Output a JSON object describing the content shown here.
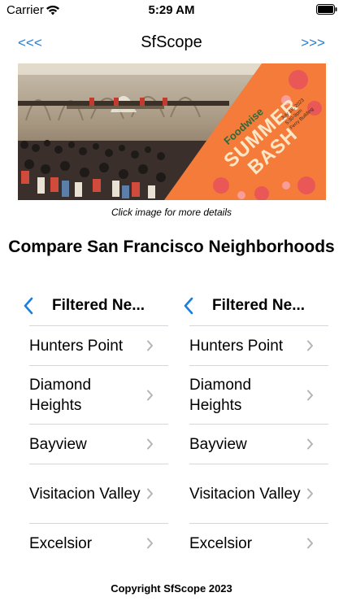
{
  "status_bar": {
    "carrier": "Carrier",
    "time": "5:29 AM"
  },
  "nav": {
    "title": "SfScope",
    "prev_label": "<<<",
    "next_label": ">>>"
  },
  "banner": {
    "caption": "Click image for more details",
    "poster": {
      "brand": "Foodwise",
      "line1": "SUMMER",
      "line2": "BASH",
      "date": "July 18, 2023",
      "time": "5:30-9pm",
      "venue": "Ferry Building"
    }
  },
  "heading": "Compare San Francisco Neighborhoods",
  "columns": [
    {
      "title": "Filtered Ne...",
      "items": [
        {
          "label": "Hunters Point"
        },
        {
          "label": "Diamond Heights"
        },
        {
          "label": "Bayview"
        },
        {
          "label": "Visitacion Valley"
        },
        {
          "label": "Excelsior"
        }
      ]
    },
    {
      "title": "Filtered Ne...",
      "items": [
        {
          "label": "Hunters Point"
        },
        {
          "label": "Diamond Heights"
        },
        {
          "label": "Bayview"
        },
        {
          "label": "Visitacion Valley"
        },
        {
          "label": "Excelsior"
        }
      ]
    }
  ],
  "footer": "Copyright SfScope 2023",
  "colors": {
    "accent": "#1a7ee0",
    "poster_orange": "#f47b3a",
    "divider": "#d6d6da"
  },
  "icons": {
    "wifi": "wifi-icon",
    "battery": "battery-icon",
    "back": "chevron-left-icon",
    "row": "chevron-right-icon"
  }
}
